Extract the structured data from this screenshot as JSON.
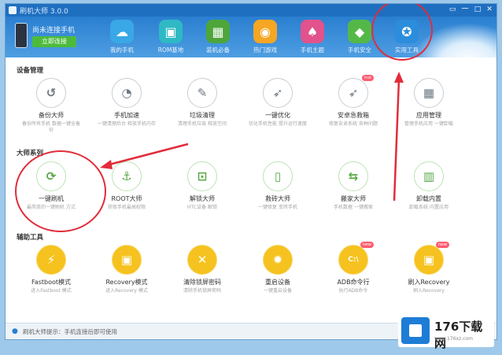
{
  "window": {
    "title": "刷机大师 3.0.0",
    "min_label": "一",
    "skin_label": "▭",
    "max_label": "□",
    "close_label": "✕"
  },
  "header": {
    "phone_name": "尚未连接手机",
    "connect_label": "立即连接",
    "nav": [
      {
        "label": "我的手机",
        "icon": "cloud-icon",
        "color": "#3aa7e6"
      },
      {
        "label": "ROM基地",
        "icon": "shopping-bag-icon",
        "color": "#2fb9c4"
      },
      {
        "label": "装机必备",
        "icon": "landscape-icon",
        "color": "#4ea53a"
      },
      {
        "label": "热门游戏",
        "icon": "gamepad-icon",
        "color": "#f5a623"
      },
      {
        "label": "手机主题",
        "icon": "shirt-icon",
        "color": "#e2528c"
      },
      {
        "label": "手机安全",
        "icon": "shield-icon",
        "color": "#54b848"
      },
      {
        "label": "实用工具",
        "icon": "wrench-icon",
        "color": "#2b8ddb"
      }
    ]
  },
  "sections": {
    "device": "设备管理",
    "master": "大师系列",
    "aux": "辅助工具"
  },
  "device_tools": [
    {
      "label": "备份大师",
      "desc": "备份所有手机 数据一键全备份",
      "icon": "backup-icon"
    },
    {
      "label": "手机加速",
      "desc": "一键清理后台 释放手机内存",
      "icon": "speedometer-icon"
    },
    {
      "label": "垃圾清理",
      "desc": "清理手机垃圾 释放空间",
      "icon": "brush-icon"
    },
    {
      "label": "一键优化",
      "desc": "优化手机性能 提升运行速度",
      "icon": "rocket-icon"
    },
    {
      "label": "安卓急救箱",
      "desc": "修复安卓系统 各种问题",
      "icon": "rocket2-icon",
      "badge": "hot"
    },
    {
      "label": "应用管理",
      "desc": "管理手机应用 一键卸载",
      "icon": "grid-icon"
    }
  ],
  "master_tools": [
    {
      "label": "一键刷机",
      "desc": "最简单的一键刷机 方式",
      "icon": "refresh-icon"
    },
    {
      "label": "ROOT大师",
      "desc": "获取手机最高权限",
      "icon": "anchor-icon"
    },
    {
      "label": "解锁大师",
      "desc": "HTC设备 解锁",
      "icon": "unlock-icon"
    },
    {
      "label": "救砖大师",
      "desc": "一键修复 变砖手机",
      "icon": "phone-icon"
    },
    {
      "label": "搬家大师",
      "desc": "手机数据 一键搬家",
      "icon": "transfer-icon"
    },
    {
      "label": "卸载内置",
      "desc": "卸载系统 内置应用",
      "icon": "trash-icon"
    }
  ],
  "aux_tools": [
    {
      "label": "Fastboot模式",
      "desc": "进入Fastboot 模式",
      "icon": "bolt-icon"
    },
    {
      "label": "Recovery模式",
      "desc": "进入Recovery 模式",
      "icon": "recovery-icon"
    },
    {
      "label": "清除锁屏密码",
      "desc": "清除手机锁屏密码",
      "icon": "cross-arrows-icon"
    },
    {
      "label": "重启设备",
      "desc": "一键重启设备",
      "icon": "gear-icon"
    },
    {
      "label": "ADB命令行",
      "desc": "执行ADB命令",
      "icon": "terminal-icon",
      "badge": "new"
    },
    {
      "label": "刷入Recovery",
      "desc": "刷入Recovery",
      "icon": "flash-icon",
      "badge": "new"
    }
  ],
  "status": {
    "text": "刷机大师提示：手机连接后即可使用"
  },
  "watermark": {
    "text": "176下载网",
    "url": "www.176xz.com"
  }
}
